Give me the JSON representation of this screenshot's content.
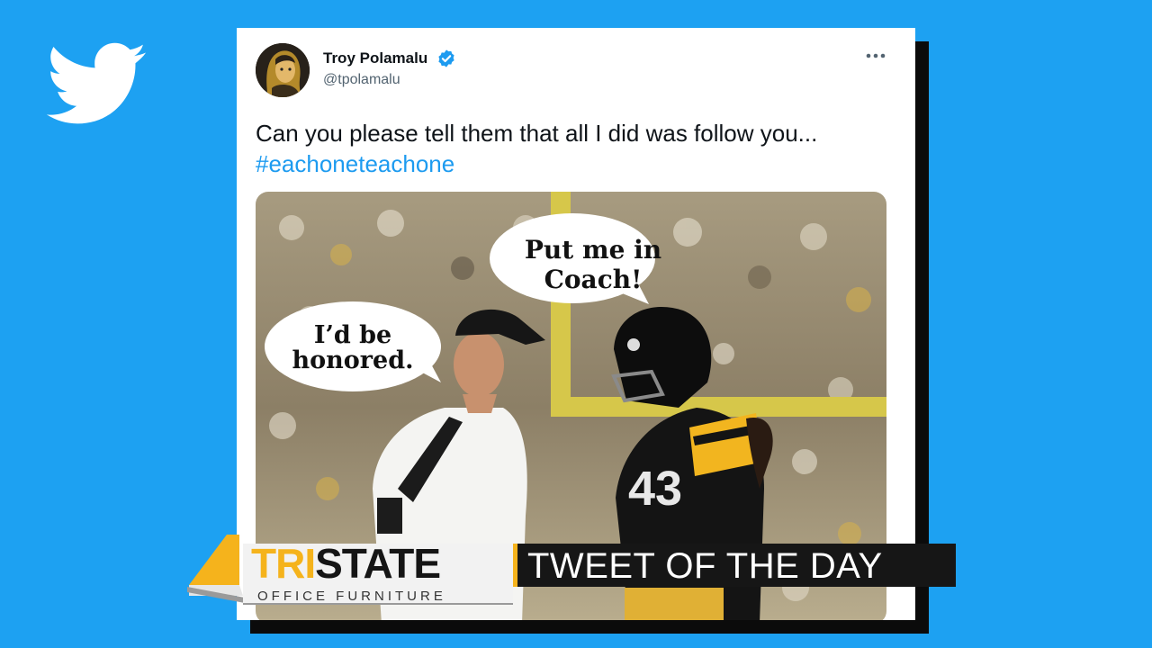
{
  "tweet": {
    "author_name": "Troy Polamalu",
    "author_handle": "@tpolamalu",
    "text": "Can you please tell them that all I did was follow you...",
    "hashtag": "#eachoneteachone",
    "image_caption_coach": "Put me in\nCoach!",
    "image_caption_player": "I’d be\nhonored."
  },
  "lower_third": {
    "brand_tri": "TRI",
    "brand_state": "STATE",
    "brand_tagline": "OFFICE FURNITURE",
    "segment_title": "TWEET OF THE DAY"
  },
  "colors": {
    "background": "#1da1f2",
    "link": "#1d9bf0",
    "verified": "#1d9bf0",
    "brand_gold": "#f5b31c"
  },
  "icons": {
    "logo": "twitter-bird-icon",
    "verified": "verified-badge-icon",
    "more": "more-options-icon"
  }
}
